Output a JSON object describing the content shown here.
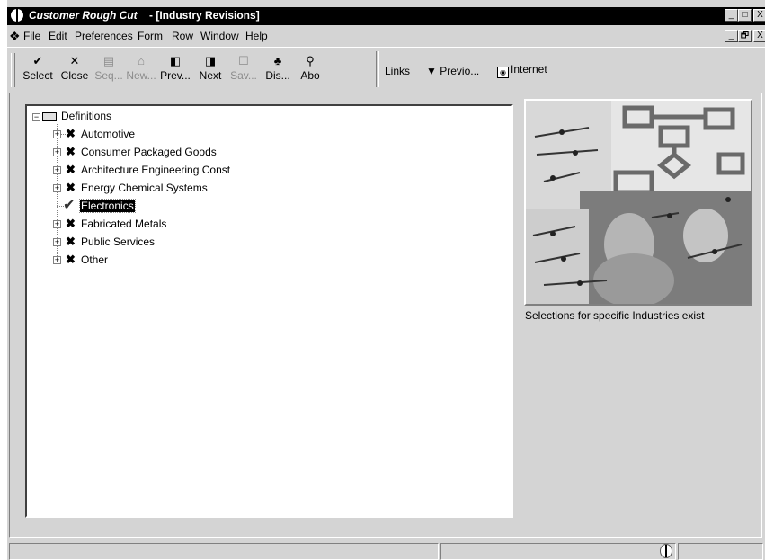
{
  "window": {
    "app_title": "Customer Rough Cut",
    "form_title": " - [Industry Revisions]",
    "controls": [
      "_",
      "□",
      "X"
    ],
    "mdi_controls": [
      "_",
      "🗗",
      "X"
    ]
  },
  "menu": {
    "items": [
      {
        "label": "File"
      },
      {
        "label": "Edit"
      },
      {
        "label": "Preferences"
      },
      {
        "label": "Form"
      },
      {
        "label": "Row"
      },
      {
        "label": "Window"
      },
      {
        "label": "Help"
      }
    ]
  },
  "toolbar": {
    "buttons": [
      {
        "label": "Select",
        "icon": "check-icon",
        "enabled": true
      },
      {
        "label": "Close",
        "icon": "x-icon",
        "enabled": true
      },
      {
        "label": "Seq...",
        "icon": "doc-icon",
        "enabled": false
      },
      {
        "label": "New...",
        "icon": "new-icon",
        "enabled": false
      },
      {
        "label": "Prev...",
        "icon": "prev-icon",
        "enabled": true
      },
      {
        "label": "Next",
        "icon": "next-icon",
        "enabled": true
      },
      {
        "label": "Sav...",
        "icon": "save-icon",
        "enabled": false
      },
      {
        "label": "Dis...",
        "icon": "display-icon",
        "enabled": true
      },
      {
        "label": "Abo",
        "icon": "help-icon",
        "enabled": true
      }
    ],
    "links_label": "Links",
    "previo_label": "Previo...",
    "internet_label": "Internet"
  },
  "tree": {
    "root": "Definitions",
    "items": [
      {
        "label": "Automotive",
        "icon": "x-mark-icon",
        "selected": false
      },
      {
        "label": "Consumer Packaged Goods",
        "icon": "x-mark-icon",
        "selected": false
      },
      {
        "label": "Architecture Engineering Const",
        "icon": "x-mark-icon",
        "selected": false
      },
      {
        "label": "Energy Chemical Systems",
        "icon": "x-mark-icon",
        "selected": false
      },
      {
        "label": "Electronics",
        "icon": "checkmark-icon",
        "selected": true
      },
      {
        "label": "Fabricated Metals",
        "icon": "x-mark-icon",
        "selected": false
      },
      {
        "label": "Public Services",
        "icon": "x-mark-icon",
        "selected": false
      },
      {
        "label": "Other",
        "icon": "x-mark-icon",
        "selected": false
      }
    ]
  },
  "side_panel": {
    "caption": "Selections for specific Industries exist"
  }
}
